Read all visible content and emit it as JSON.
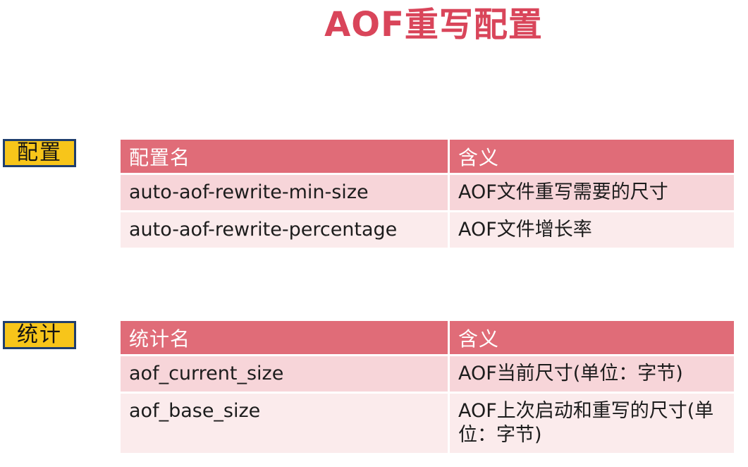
{
  "title": "AOF重写配置",
  "config": {
    "tag": "配置",
    "headers": [
      "配置名",
      "含义"
    ],
    "rows": [
      [
        "auto-aof-rewrite-min-size",
        "AOF文件重写需要的尺寸"
      ],
      [
        "auto-aof-rewrite-percentage",
        "AOF文件增长率"
      ]
    ]
  },
  "stats": {
    "tag": "统计",
    "headers": [
      "统计名",
      "含义"
    ],
    "rows": [
      [
        "aof_current_size",
        "AOF当前尺寸(单位：字节)"
      ],
      [
        "aof_base_size",
        "AOF上次启动和重写的尺寸(单位：字节)"
      ]
    ]
  },
  "colors": {
    "title": "#d9455a",
    "header_bg": "#e06c78",
    "row_odd": "#f7d5d9",
    "row_even": "#fbebec",
    "tag_bg": "#f7c51a",
    "tag_border": "#1f3e6e"
  }
}
